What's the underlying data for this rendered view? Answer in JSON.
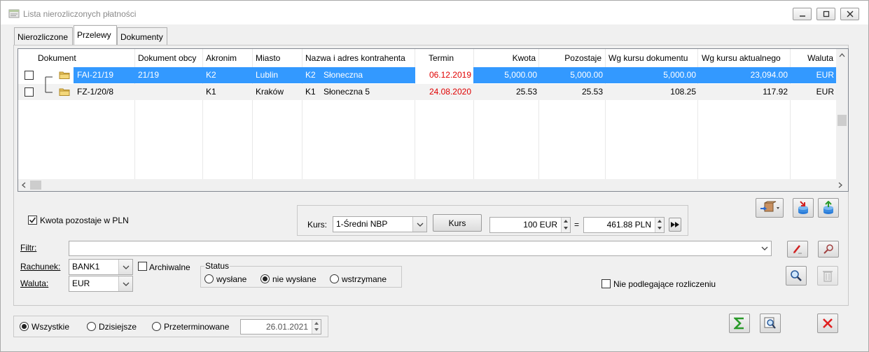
{
  "window": {
    "title": "Lista nierozliczonych płatności"
  },
  "tabs": [
    {
      "label": "Nierozliczone"
    },
    {
      "label": "Przelewy"
    },
    {
      "label": "Dokumenty"
    }
  ],
  "grid": {
    "columns": [
      "Dokument",
      "Dokument obcy",
      "Akronim",
      "Miasto",
      "Nazwa i adres kontrahenta",
      "Termin",
      "Kwota",
      "Pozostaje",
      "Wg kursu dokumentu",
      "Wg kursu aktualnego",
      "Waluta"
    ],
    "rows": [
      {
        "dokument": "FAI-21/19",
        "dokument_obcy": "21/19",
        "akronim": "K2",
        "miasto": "Lublin",
        "kontrahent_kod": "K2",
        "kontrahent_nazwa": "Słoneczna",
        "termin": "06.12.2019",
        "kwota": "5,000.00",
        "pozostaje": "5,000.00",
        "wg_kursu_dokumentu": "5,000.00",
        "wg_kursu_aktualnego": "23,094.00",
        "waluta": "EUR",
        "selected": true
      },
      {
        "dokument": "FZ-1/20/8",
        "dokument_obcy": "",
        "akronim": "K1",
        "miasto": "Kraków",
        "kontrahent_kod": "K1",
        "kontrahent_nazwa": "Słoneczna 5",
        "termin": "24.08.2020",
        "kwota": "25.53",
        "pozostaje": "25.53",
        "wg_kursu_dokumentu": "108.25",
        "wg_kursu_aktualnego": "117.92",
        "waluta": "EUR",
        "selected": false
      }
    ]
  },
  "kwota_pln": {
    "label": "Kwota pozostaje w PLN",
    "checked": true
  },
  "kurs": {
    "label": "Kurs:",
    "selected": "1-Średni NBP",
    "button_label": "Kurs",
    "amount_from": "100 EUR",
    "equals": "=",
    "amount_to": "461.88 PLN"
  },
  "filter": {
    "label": "Filtr:",
    "value": ""
  },
  "rachunek": {
    "label": "Rachunek:",
    "value": "BANK1"
  },
  "waluta": {
    "label": "Waluta:",
    "value": "EUR"
  },
  "archiwalne": {
    "label": "Archiwalne",
    "checked": false
  },
  "status": {
    "label": "Status",
    "options": [
      {
        "label": "wysłane",
        "selected": false
      },
      {
        "label": "nie wysłane",
        "selected": true
      },
      {
        "label": "wstrzymane",
        "selected": false
      }
    ]
  },
  "nie_podlegajace": {
    "label": "Nie podlegające rozliczeniu",
    "checked": false
  },
  "date_filter": {
    "options": [
      {
        "label": "Wszystkie",
        "selected": true
      },
      {
        "label": "Dzisiejsze",
        "selected": false
      },
      {
        "label": "Przeterminowane",
        "selected": false
      }
    ],
    "date": "26.01.2021"
  },
  "colors": {
    "selection": "#3399ff",
    "overdue": "#e00000",
    "close_red": "#e02020",
    "sum_green": "#2a9a2a"
  }
}
